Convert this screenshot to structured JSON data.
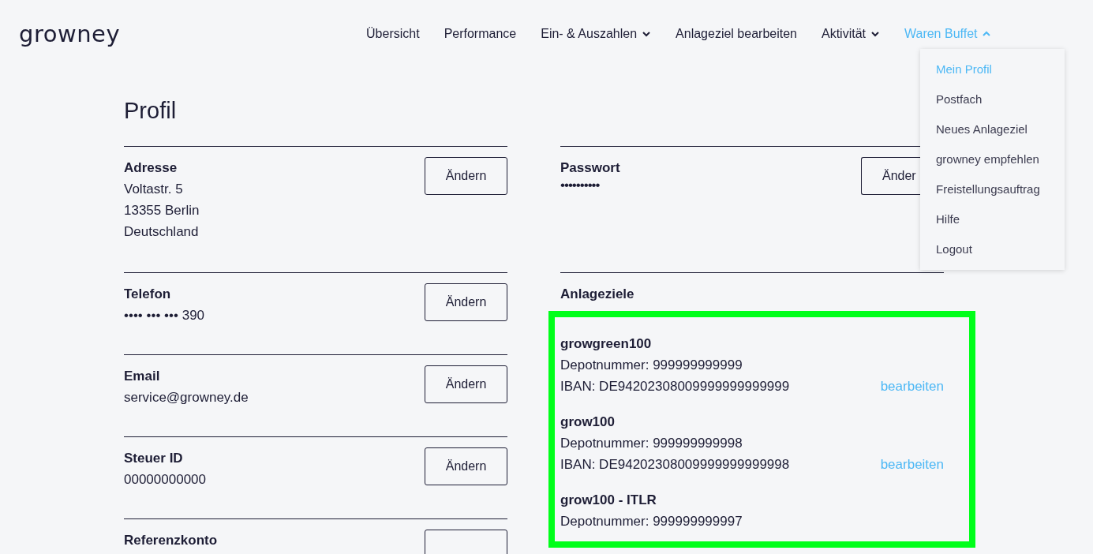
{
  "logo": "growney",
  "nav": [
    {
      "label": "Übersicht",
      "dropdown": false,
      "selected": false
    },
    {
      "label": "Performance",
      "dropdown": false,
      "selected": false
    },
    {
      "label": "Ein- & Auszahlen",
      "dropdown": true,
      "expanded": false,
      "selected": false
    },
    {
      "label": "Anlageziel bearbeiten",
      "dropdown": false,
      "selected": false
    },
    {
      "label": "Aktivität",
      "dropdown": true,
      "expanded": false,
      "selected": false
    },
    {
      "label": "Waren Buffet",
      "dropdown": true,
      "expanded": true,
      "selected": true
    }
  ],
  "user_menu": [
    {
      "label": "Mein Profil",
      "selected": true
    },
    {
      "label": "Postfach",
      "selected": false
    },
    {
      "label": "Neues Anlageziel",
      "selected": false
    },
    {
      "label": "growney empfehlen",
      "selected": false
    },
    {
      "label": "Freistellungsauftrag",
      "selected": false
    },
    {
      "label": "Hilfe",
      "selected": false
    },
    {
      "label": "Logout",
      "selected": false
    }
  ],
  "title": "Profil",
  "left_sections": [
    {
      "label": "Adresse",
      "lines": [
        "Voltastr. 5",
        "13355 Berlin",
        "Deutschland"
      ],
      "button": "Ändern"
    },
    {
      "label": "Telefon",
      "lines": [
        "•••• ••• ••• 390"
      ],
      "button": "Ändern"
    },
    {
      "label": "Email",
      "lines": [
        "service@growney.de"
      ],
      "button": "Ändern"
    },
    {
      "label": "Steuer ID",
      "lines": [
        "00000000000"
      ],
      "button": "Ändern"
    },
    {
      "label": "Referenzkonto"
    }
  ],
  "password": {
    "label": "Passwort",
    "value": "••••••••••",
    "button": "Änder"
  },
  "goals": {
    "title": "Anlageziele",
    "items": [
      {
        "name": "growgreen100",
        "depot": "Depotnummer: 999999999999",
        "iban": "IBAN: DE94202308009999999999999",
        "link": "bearbeiten"
      },
      {
        "name": "grow100",
        "depot": "Depotnummer: 999999999998",
        "iban": "IBAN: DE94202308009999999999998",
        "link": "bearbeiten"
      },
      {
        "name": "grow100 - ITLR",
        "depot": "Depotnummer: 999999999997"
      }
    ]
  }
}
